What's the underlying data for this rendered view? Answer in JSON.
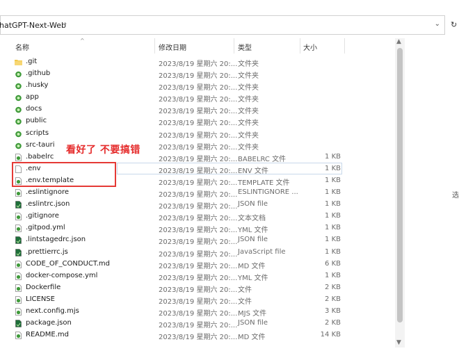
{
  "address": {
    "path": "hatGPT-Next-Web",
    "chevron": "›",
    "dropdown": "⌄",
    "refresh": "↻"
  },
  "columns": {
    "name": "名称",
    "date": "修改日期",
    "type": "类型",
    "size": "大小"
  },
  "annotation": "看好了 不要搞错",
  "side_text": "选",
  "files": [
    {
      "name": ".git",
      "date": "2023/8/19 星期六 20:...",
      "type": "文件夹",
      "size": "",
      "icon": "folder-icon"
    },
    {
      "name": ".github",
      "date": "2023/8/19 星期六 20:...",
      "type": "文件夹",
      "size": "",
      "icon": "folder-green-icon"
    },
    {
      "name": ".husky",
      "date": "2023/8/19 星期六 20:...",
      "type": "文件夹",
      "size": "",
      "icon": "folder-green-icon"
    },
    {
      "name": "app",
      "date": "2023/8/19 星期六 20:...",
      "type": "文件夹",
      "size": "",
      "icon": "folder-green-icon"
    },
    {
      "name": "docs",
      "date": "2023/8/19 星期六 20:...",
      "type": "文件夹",
      "size": "",
      "icon": "folder-green-icon"
    },
    {
      "name": "public",
      "date": "2023/8/19 星期六 20:...",
      "type": "文件夹",
      "size": "",
      "icon": "folder-green-icon"
    },
    {
      "name": "scripts",
      "date": "2023/8/19 星期六 20:...",
      "type": "文件夹",
      "size": "",
      "icon": "folder-green-icon"
    },
    {
      "name": "src-tauri",
      "date": "2023/8/19 星期六 20:...",
      "type": "文件夹",
      "size": "",
      "icon": "folder-green-icon"
    },
    {
      "name": ".babelrc",
      "date": "2023/8/19 星期六 20:...",
      "type": "BABELRC 文件",
      "size": "1 KB",
      "icon": "file-green-icon"
    },
    {
      "name": ".env",
      "date": "2023/8/19 星期六 20:...",
      "type": "ENV 文件",
      "size": "1 KB",
      "icon": "file-blank-icon"
    },
    {
      "name": ".env.template",
      "date": "2023/8/19 星期六 20:...",
      "type": "TEMPLATE 文件",
      "size": "1 KB",
      "icon": "file-green-icon"
    },
    {
      "name": ".eslintignore",
      "date": "2023/8/19 星期六 20:...",
      "type": "ESLINTIGNORE ...",
      "size": "1 KB",
      "icon": "file-green-icon"
    },
    {
      "name": ".eslintrc.json",
      "date": "2023/8/19 星期六 20:...",
      "type": "JSON file",
      "size": "1 KB",
      "icon": "file-dark-icon"
    },
    {
      "name": ".gitignore",
      "date": "2023/8/19 星期六 20:...",
      "type": "文本文档",
      "size": "1 KB",
      "icon": "file-green-icon"
    },
    {
      "name": ".gitpod.yml",
      "date": "2023/8/19 星期六 20:...",
      "type": "YML 文件",
      "size": "1 KB",
      "icon": "file-green-icon"
    },
    {
      "name": ".lintstagedrc.json",
      "date": "2023/8/19 星期六 20:...",
      "type": "JSON file",
      "size": "1 KB",
      "icon": "file-dark-icon"
    },
    {
      "name": ".prettierrc.js",
      "date": "2023/8/19 星期六 20:...",
      "type": "JavaScript file",
      "size": "1 KB",
      "icon": "file-dark-icon"
    },
    {
      "name": "CODE_OF_CONDUCT.md",
      "date": "2023/8/19 星期六 20:...",
      "type": "MD 文件",
      "size": "6 KB",
      "icon": "file-green-icon"
    },
    {
      "name": "docker-compose.yml",
      "date": "2023/8/19 星期六 20:...",
      "type": "YML 文件",
      "size": "1 KB",
      "icon": "file-green-icon"
    },
    {
      "name": "Dockerfile",
      "date": "2023/8/19 星期六 20:...",
      "type": "文件",
      "size": "2 KB",
      "icon": "file-green-icon"
    },
    {
      "name": "LICENSE",
      "date": "2023/8/19 星期六 20:...",
      "type": "文件",
      "size": "2 KB",
      "icon": "file-green-icon"
    },
    {
      "name": "next.config.mjs",
      "date": "2023/8/19 星期六 20:...",
      "type": "MJS 文件",
      "size": "3 KB",
      "icon": "file-green-icon"
    },
    {
      "name": "package.json",
      "date": "2023/8/19 星期六 20:...",
      "type": "JSON file",
      "size": "2 KB",
      "icon": "file-dark-icon"
    },
    {
      "name": "README.md",
      "date": "2023/8/19 星期六 20:...",
      "type": "MD 文件",
      "size": "14 KB",
      "icon": "file-green-icon"
    }
  ]
}
